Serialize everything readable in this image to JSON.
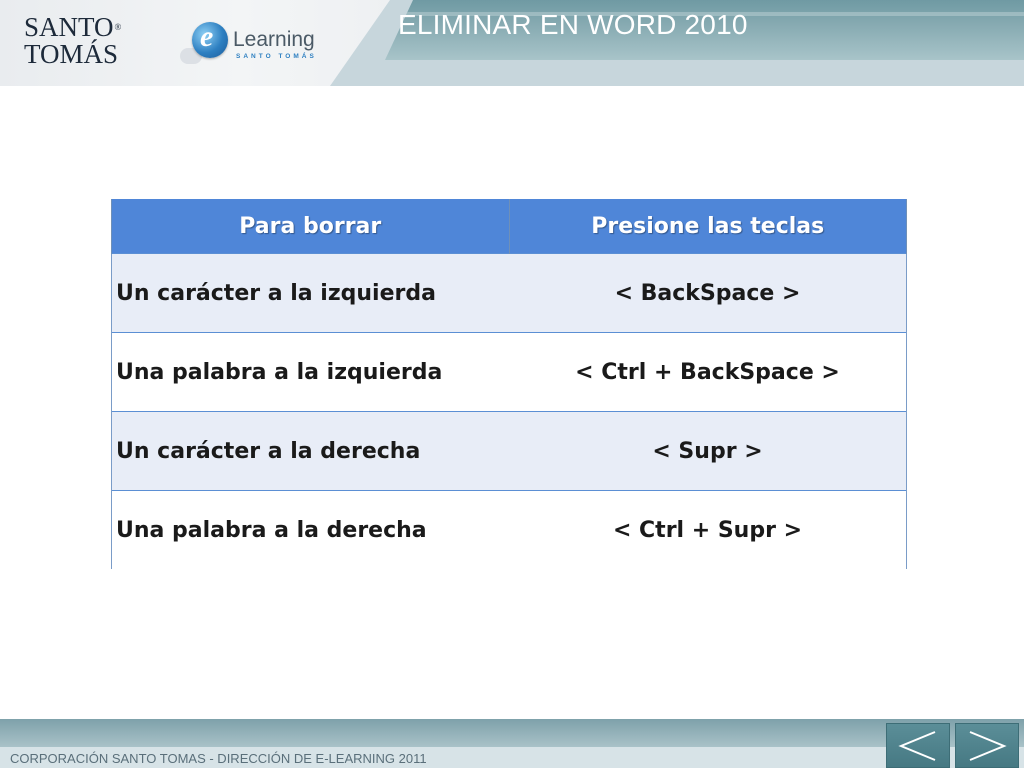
{
  "header": {
    "title": "ELIMINAR EN WORD 2010",
    "logo_lines": [
      "SANTO",
      "TOMÁS"
    ],
    "logo_mark": "®",
    "elearning_word": "Learning",
    "elearning_letter": "e",
    "elearning_sub": "SANTO TOMÁS"
  },
  "table": {
    "headers": [
      "Para borrar",
      "Presione las teclas"
    ],
    "rows": [
      {
        "action": "Un carácter a la izquierda",
        "keys": "< BackSpace >"
      },
      {
        "action": "Una palabra a la izquierda",
        "keys": "< Ctrl + BackSpace >"
      },
      {
        "action": "Un carácter a la derecha",
        "keys": "< Supr >"
      },
      {
        "action": "Una palabra a la derecha",
        "keys": "< Ctrl + Supr >"
      }
    ]
  },
  "footer": {
    "text": "CORPORACIÓN SANTO TOMAS - DIRECCIÓN DE E-LEARNING  2011"
  },
  "nav": {
    "prev_icon": "chevron-left-icon",
    "next_icon": "chevron-right-icon"
  },
  "colors": {
    "header_band": "#89acb3",
    "table_header": "#4f86d8",
    "row_alt": "#e8edf7",
    "nav_button": "#4f838d"
  }
}
